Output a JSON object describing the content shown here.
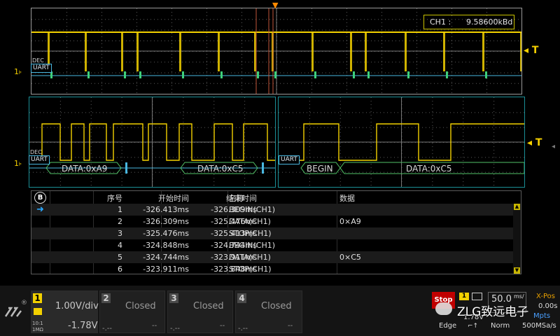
{
  "upper_window": {
    "ch1_label": "CH1 :",
    "ch1_value": "9.58600kBd",
    "trigger_label": "T",
    "channel_marker": "1",
    "tag_dec": "DEC",
    "tag_uart": "UART"
  },
  "zoom_left": {
    "tag_uart": "UART",
    "tag_dec": "DEC",
    "channel_marker": "1",
    "decode_segments": [
      "DATA:0xA9",
      "DATA:0xC5"
    ]
  },
  "zoom_right": {
    "tag_uart": "UART",
    "trigger_label": "T",
    "decode_segments": [
      "BEGIN",
      "DATA:0xC5"
    ]
  },
  "decode_table": {
    "headers": {
      "index": "序号",
      "start": "开始时间",
      "end": "结束时间",
      "name": "名称",
      "data": "数据"
    },
    "rows": [
      {
        "index": "1",
        "start": "-326.413ms",
        "end": "-326.309ms",
        "name": "BEGIN(CH1)",
        "data": ""
      },
      {
        "index": "2",
        "start": "-326.309ms",
        "end": "-325.476ms",
        "name": "DATA(CH1)",
        "data": "0×A9"
      },
      {
        "index": "3",
        "start": "-325.476ms",
        "end": "-325.413ms",
        "name": "STOP(CH1)",
        "data": ""
      },
      {
        "index": "4",
        "start": "-324.848ms",
        "end": "-324.744ms",
        "name": "BEGIN(CH1)",
        "data": ""
      },
      {
        "index": "5",
        "start": "-324.744ms",
        "end": "-323.911ms",
        "name": "DATA(CH1)",
        "data": "0×C5"
      },
      {
        "index": "6",
        "start": "-323.911ms",
        "end": "-323.848ms",
        "name": "STOP(CH1)",
        "data": ""
      }
    ],
    "selected_row": 1
  },
  "channels": [
    {
      "num": "1",
      "scale": "1.00V/div",
      "offset": "-1.78V",
      "coupling_a": "10:1",
      "coupling_b": "1MΩ",
      "active": true
    },
    {
      "num": "2",
      "state": "Closed",
      "left_dash": "-.--",
      "right_dash": "--",
      "active": false
    },
    {
      "num": "3",
      "state": "Closed",
      "left_dash": "-.--",
      "right_dash": "--",
      "active": false
    },
    {
      "num": "4",
      "state": "Closed",
      "left_dash": "-.--",
      "right_dash": "--",
      "active": false
    }
  ],
  "status": {
    "run_state": "Stop",
    "trigger_source": "1",
    "trigger_level": "1.78V",
    "trigger_type": "Edge",
    "timebase": "50.0",
    "timebase_unit": "ms/",
    "mode": "Norm",
    "xpos_label": "X-Pos",
    "xpos_value": "0.00s",
    "memory": "Mpts",
    "sample_rate": "500MSa/s",
    "brand_text": "ZLG致远电子",
    "brand_mark": "ZLG"
  },
  "colors": {
    "ch1": "#f3d100",
    "decode": "#49b7e0",
    "bus_frame": "#52c267"
  }
}
